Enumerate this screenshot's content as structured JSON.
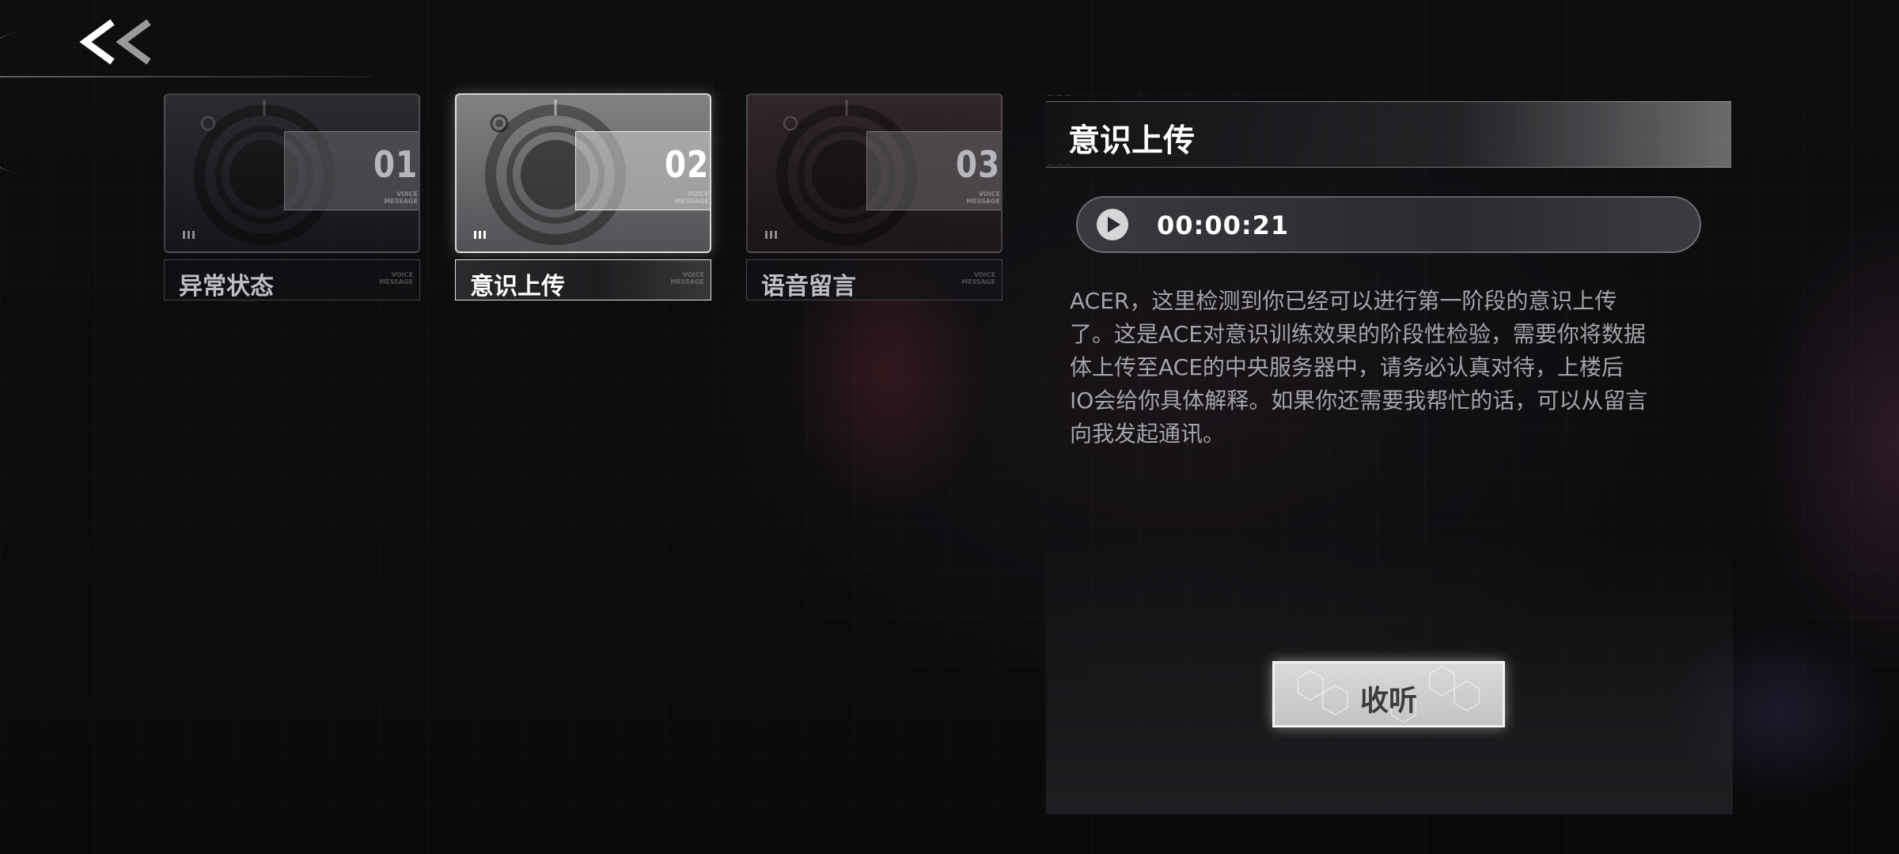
{
  "nav": {
    "back_icon": "double-chevron-left-icon"
  },
  "cards": [
    {
      "number": "01",
      "label": "异常状态",
      "tiny": "VOICE MESSAGE",
      "active": false
    },
    {
      "number": "02",
      "label": "意识上传",
      "tiny": "VOICE MESSAGE",
      "active": true
    },
    {
      "number": "03",
      "label": "语音留言",
      "tiny": "VOICE MESSAGE",
      "active": false
    }
  ],
  "detail": {
    "title": "意识上传",
    "audio": {
      "duration": "00:00:21",
      "play_icon": "play-icon"
    },
    "message_lines": [
      "ACER，这里检测到你已经可以进行第一阶段的意识上传",
      "了。这是ACE对意识训练效果的阶段性检验，需要你将数据",
      "体上传至ACE的中央服务器中，请务必认真对待，上楼后",
      "IO会给你具体解释。如果你还需要我帮忙的话，可以从留言",
      "向我发起通讯。"
    ],
    "listen_label": "收听"
  },
  "colors": {
    "background": "#0c0c0e",
    "active_card": "#9a9a9c",
    "text_muted": "#a4a4a8",
    "button_face": "#d0d0d0"
  }
}
